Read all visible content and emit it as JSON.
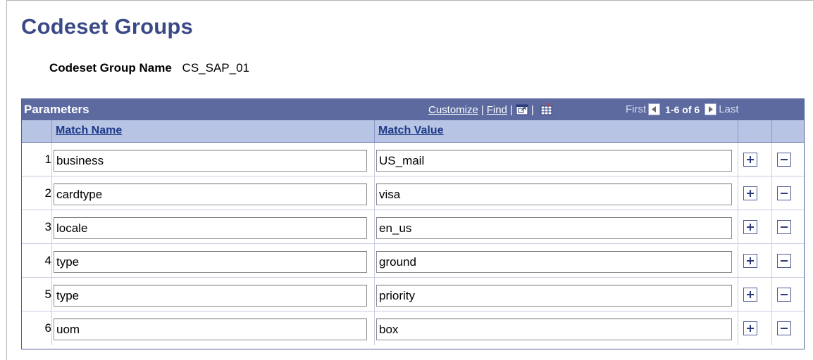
{
  "page": {
    "title": "Codeset Groups"
  },
  "group": {
    "label": "Codeset Group Name",
    "value": "CS_SAP_01"
  },
  "grid": {
    "title": "Parameters",
    "customize": "Customize",
    "separator": "|",
    "find": "Find",
    "pager": {
      "first": "First",
      "count": "1-6 of 6",
      "last": "Last"
    },
    "columns": {
      "match_name": "Match Name",
      "match_value": "Match Value"
    },
    "rows": [
      {
        "num": "1",
        "name": "business",
        "value": "US_mail"
      },
      {
        "num": "2",
        "name": "cardtype",
        "value": "visa"
      },
      {
        "num": "3",
        "name": "locale",
        "value": "en_us"
      },
      {
        "num": "4",
        "name": "type",
        "value": "ground"
      },
      {
        "num": "5",
        "name": "type",
        "value": "priority"
      },
      {
        "num": "6",
        "name": "uom",
        "value": "box"
      }
    ]
  },
  "icons": {
    "zoom": "view-all-icon",
    "download": "download-grid-icon",
    "prev": "previous-arrow-icon",
    "next": "next-arrow-icon",
    "add": "add-row-icon",
    "delete": "delete-row-icon"
  },
  "colors": {
    "title": "#3b4a87",
    "grid_header": "#5c6aa0",
    "column_header": "#b8c4e3",
    "link": "#1e3a8a"
  }
}
